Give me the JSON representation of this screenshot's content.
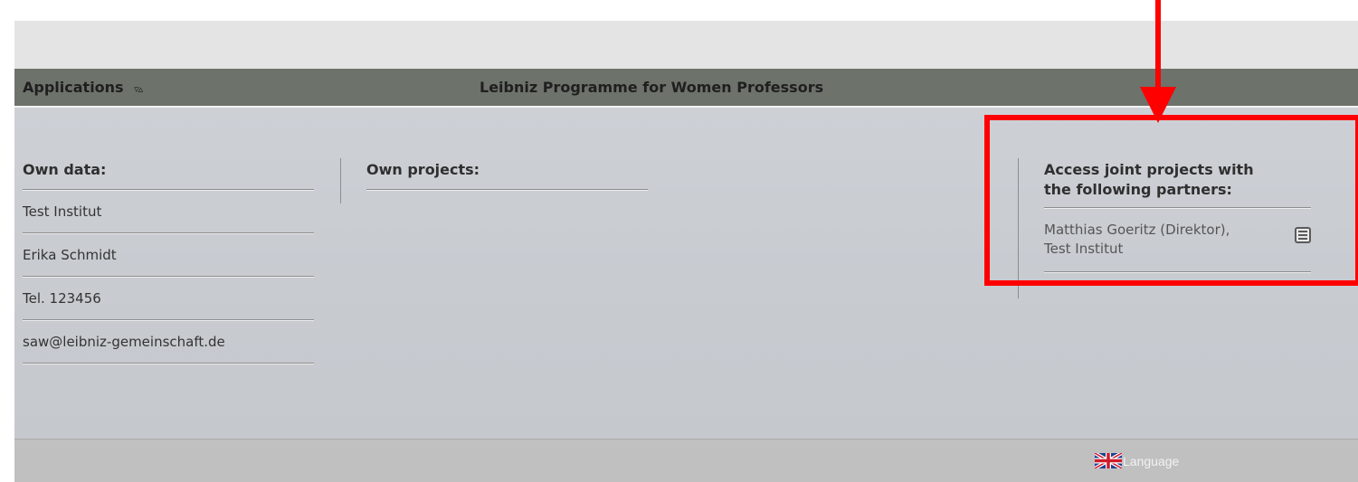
{
  "app_bar": {
    "applications_label": "Applications",
    "sort_toggle": "▿▵",
    "title": "Leibniz Programme for Women Professors"
  },
  "own_data": {
    "heading": "Own data:",
    "items": [
      "Test Institut",
      "Erika Schmidt",
      "Tel. 123456",
      "saw@leibniz-gemeinschaft.de"
    ]
  },
  "own_projects": {
    "heading": "Own projects:"
  },
  "partners": {
    "heading_line1": "Access joint projects with",
    "heading_line2": "the following partners:",
    "items": [
      {
        "line1": "Matthias Goeritz (Direktor),",
        "line2": "Test Institut",
        "icon": "details-list-icon"
      }
    ]
  },
  "footer": {
    "language_label": "Language",
    "language_icon": "uk-flag-icon"
  },
  "colors": {
    "app_bar": "#6d726b",
    "content_bg": "#c8ccd1",
    "footer_bg": "#c0c0c0",
    "annotation": "#ff0000"
  }
}
